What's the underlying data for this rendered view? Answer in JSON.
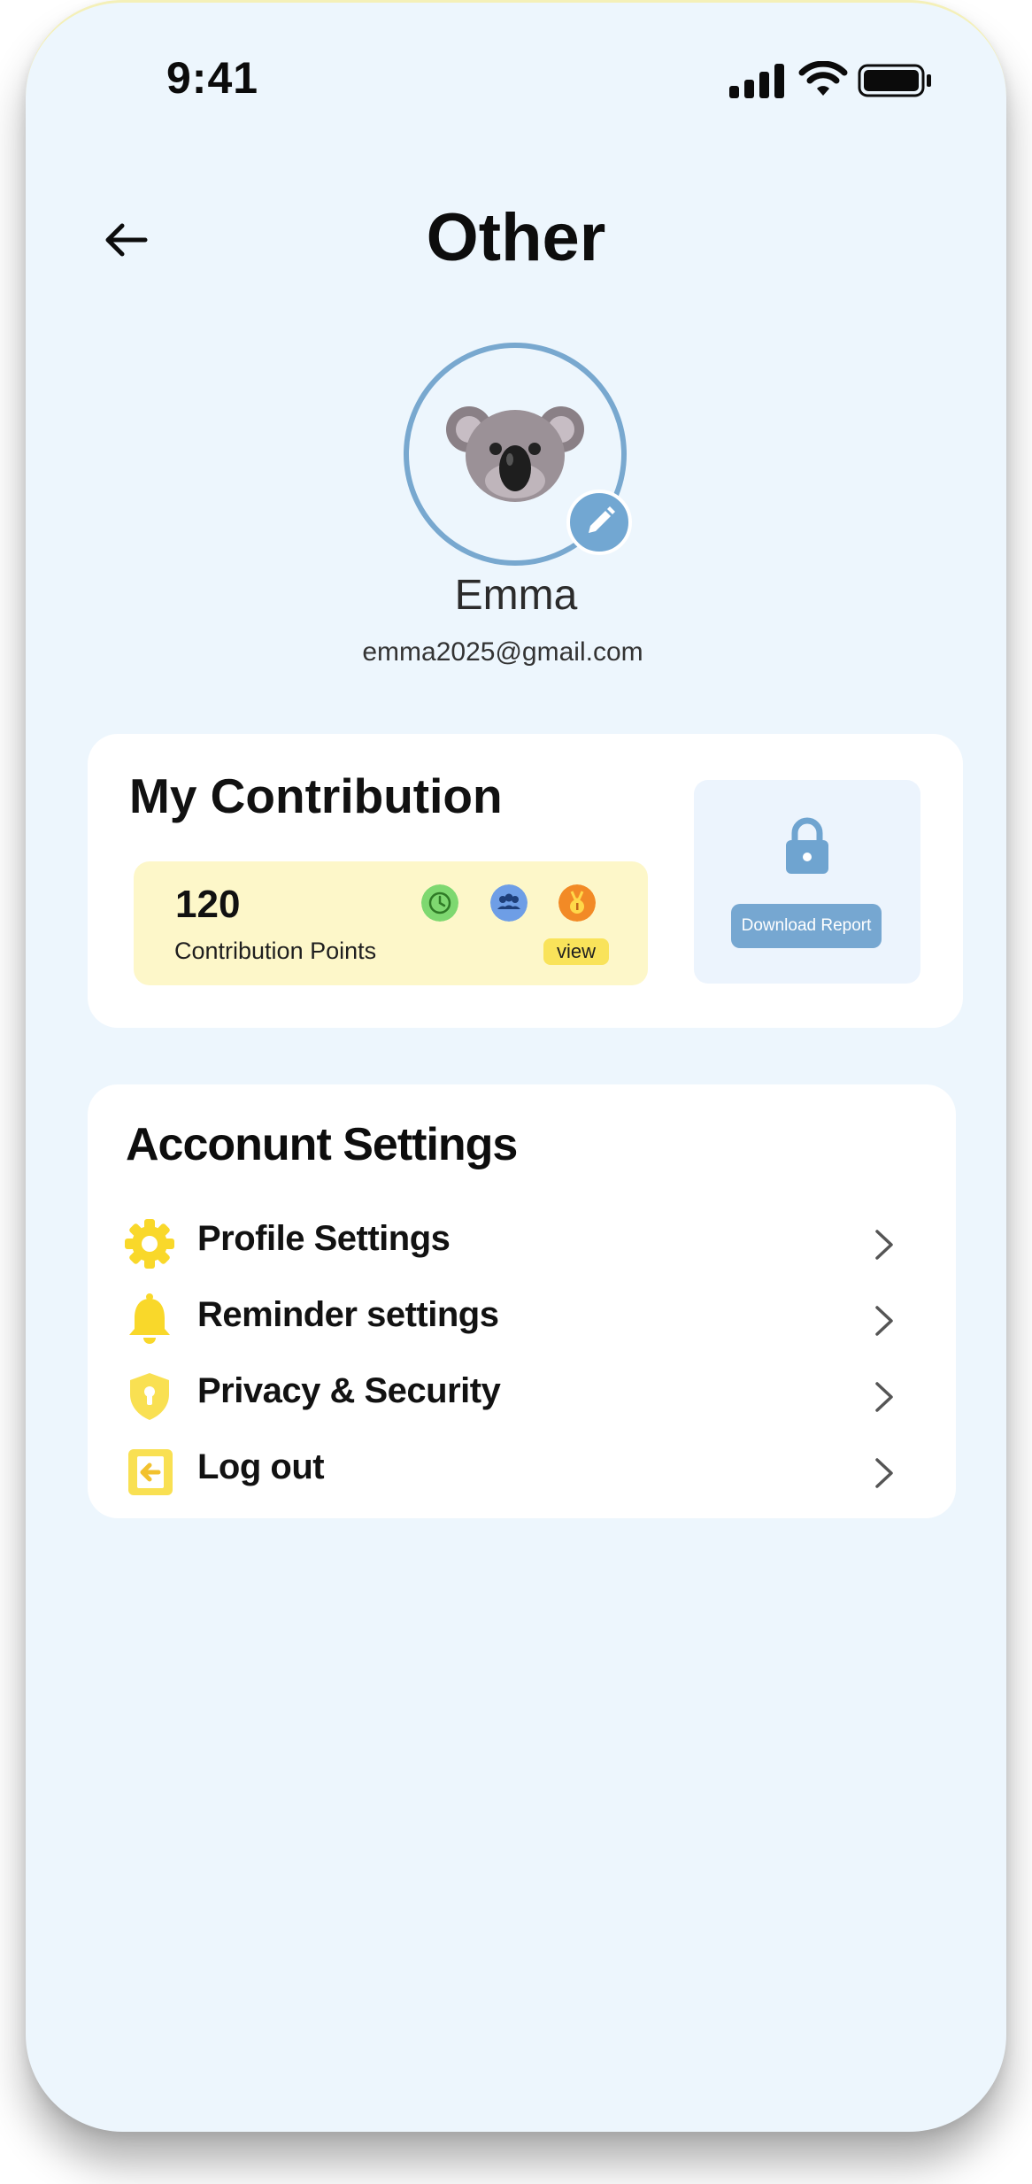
{
  "status_bar": {
    "time": "9:41",
    "icons": [
      "cellular-signal-icon",
      "wifi-icon",
      "battery-icon"
    ]
  },
  "header": {
    "title": "Other",
    "back_icon": "arrow-left-icon"
  },
  "profile": {
    "avatar_icon": "koala-avatar",
    "edit_icon": "pencil-icon",
    "name": "Emma",
    "email": "emma2025@gmail.com"
  },
  "contribution": {
    "title": "My Contribution",
    "points_value": "120",
    "points_label": "Contribution Points",
    "badges": [
      "clock-badge-icon",
      "group-badge-icon",
      "medal-badge-icon"
    ],
    "view_label": "view",
    "download_label": "Download Report",
    "lock_icon": "lock-icon"
  },
  "settings": {
    "title": "Acconunt Settings",
    "items": [
      {
        "label": "Profile Settings",
        "icon": "gear-icon"
      },
      {
        "label": "Reminder settings",
        "icon": "bell-icon"
      },
      {
        "label": "Privacy & Security",
        "icon": "shield-lock-icon"
      },
      {
        "label": "Log out",
        "icon": "logout-icon"
      }
    ]
  },
  "colors": {
    "background": "#edf6fd",
    "accent_blue": "#76a7d1",
    "accent_yellow": "#f9d82a",
    "points_bg": "#fdf7c9"
  }
}
